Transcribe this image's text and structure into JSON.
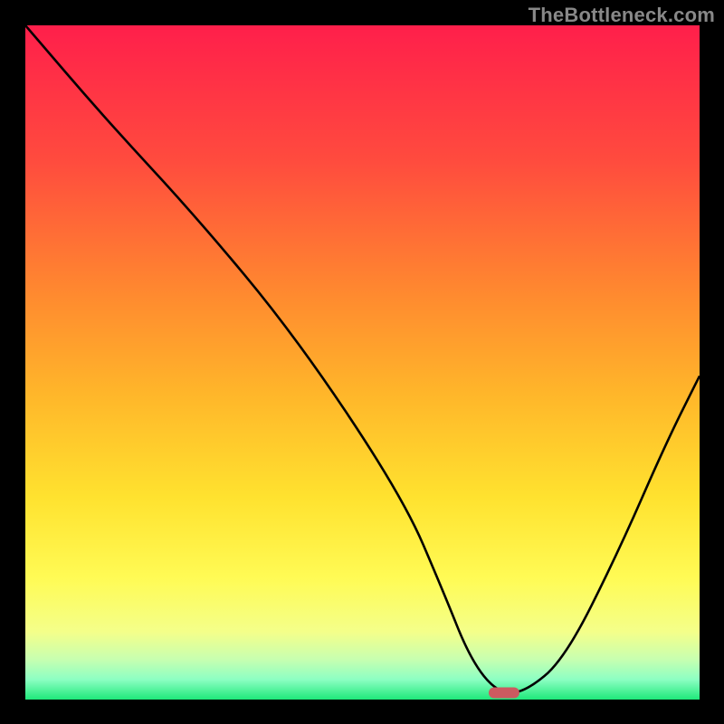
{
  "watermark": "TheBottleneck.com",
  "chart_data": {
    "type": "line",
    "title": "",
    "xlabel": "",
    "ylabel": "",
    "xlim": [
      0,
      100
    ],
    "ylim": [
      0,
      100
    ],
    "grid": false,
    "legend": false,
    "series": [
      {
        "name": "bottleneck-curve",
        "x": [
          0,
          12,
          25,
          40,
          56,
          62,
          66,
          70,
          74,
          80,
          88,
          95,
          100
        ],
        "values": [
          100,
          86,
          72,
          54,
          30,
          16,
          6,
          1,
          1,
          6,
          22,
          38,
          48
        ]
      }
    ],
    "marker": {
      "name": "optimal-point",
      "x": 71,
      "y": 1,
      "color": "#cc5a60"
    },
    "background": {
      "stops": [
        {
          "offset": 0.0,
          "color": "#ff1f4b"
        },
        {
          "offset": 0.2,
          "color": "#ff4b3e"
        },
        {
          "offset": 0.4,
          "color": "#ff8a2f"
        },
        {
          "offset": 0.55,
          "color": "#ffb72a"
        },
        {
          "offset": 0.7,
          "color": "#ffe22f"
        },
        {
          "offset": 0.82,
          "color": "#fffb55"
        },
        {
          "offset": 0.9,
          "color": "#f4ff8a"
        },
        {
          "offset": 0.94,
          "color": "#c8ffb0"
        },
        {
          "offset": 0.97,
          "color": "#8dffc3"
        },
        {
          "offset": 1.0,
          "color": "#1fe97a"
        }
      ]
    }
  }
}
